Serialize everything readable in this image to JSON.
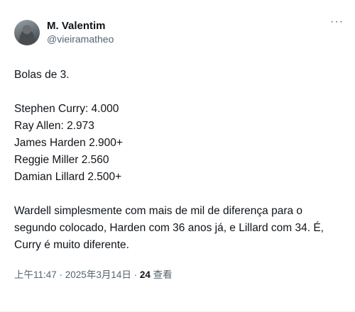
{
  "author": {
    "display_name": "M. Valentim",
    "handle": "@vieiramatheo"
  },
  "more_label": "···",
  "tweet": {
    "intro": "Bolas de 3.",
    "list": [
      "Stephen Curry: 4.000",
      "Ray Allen: 2.973",
      "James Harden 2.900+",
      "Reggie Miller 2.560",
      "Damian Lillard 2.500+"
    ],
    "conclusion": "Wardell simplesmente com mais de mil de diferença para o segundo colocado, Harden com 36 anos já, e Lillard com 34. É, Curry é muito diferente."
  },
  "meta": {
    "time": "上午11:47",
    "date": "2025年3月14日",
    "separator": " · ",
    "views_count": "24",
    "views_label": "查看"
  }
}
